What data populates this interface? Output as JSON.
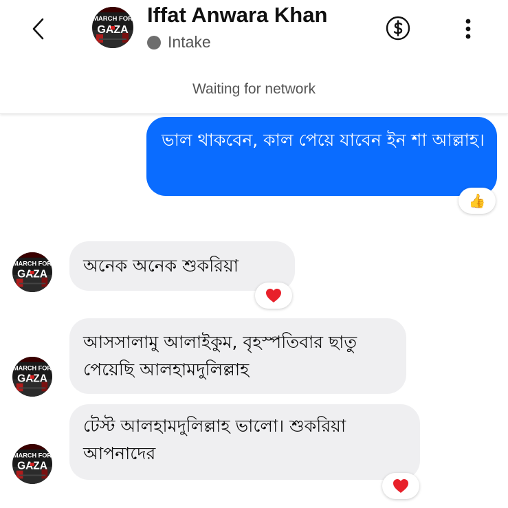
{
  "header": {
    "contact_name": "Iffat Anwara Khan",
    "status_label": "Intake",
    "network_status": "Waiting for network",
    "avatar_text": {
      "line1": "MARCH FOR",
      "line2": "GAZA"
    }
  },
  "icons": {
    "back": "chevron-left-icon",
    "payment": "dollar-circle-icon",
    "menu": "more-vertical-icon",
    "status": "gray-dot-icon"
  },
  "colors": {
    "outgoing_bubble": "#0a6cff",
    "incoming_bubble": "#efeff1",
    "heart": "#e8202a",
    "thumb": "#f0b21a"
  },
  "messages": [
    {
      "direction": "outgoing",
      "text": "ভাল থাকবেন, কাল পেয়ে যাবেন ইন শা আল্লাহ।",
      "reaction": "👍"
    },
    {
      "direction": "incoming",
      "text": "অনেক অনেক শুকরিয়া",
      "reaction": "❤️"
    },
    {
      "direction": "incoming",
      "text": "আসসালামু আলাইকুম,  বৃহস্পতিবার ছাতু পেয়েছি আলহামদুলিল্লাহ",
      "reaction": null
    },
    {
      "direction": "incoming",
      "text": "টেস্ট আলহামদুলিল্লাহ ভালো। শুকরিয়া আপনাদের",
      "reaction": "❤️"
    }
  ]
}
